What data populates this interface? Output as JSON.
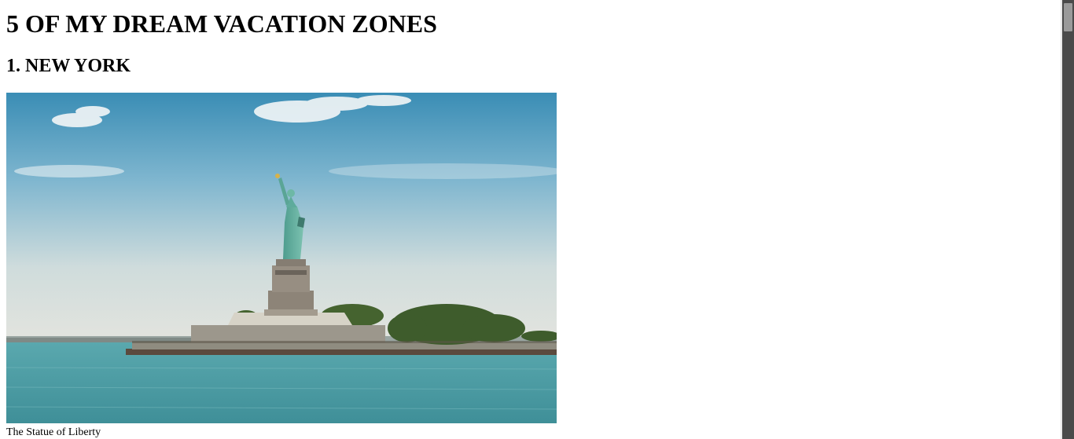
{
  "page": {
    "title": "5 OF MY DREAM VACATION ZONES"
  },
  "section": {
    "heading": "1. NEW YORK",
    "image": {
      "icon": "statue-of-liberty-photo"
    },
    "caption": "The Statue of Liberty"
  },
  "colors": {
    "sky_top": "#3f92b8",
    "sky_bottom": "#e2e4df",
    "water": "#4f9ea6",
    "statue": "#5fae9e",
    "pedestal": "#8c857b",
    "trees": "#3d5a2b",
    "scrollbar_track": "#4a4a4a",
    "scrollbar_thumb": "#9a9a9a"
  }
}
